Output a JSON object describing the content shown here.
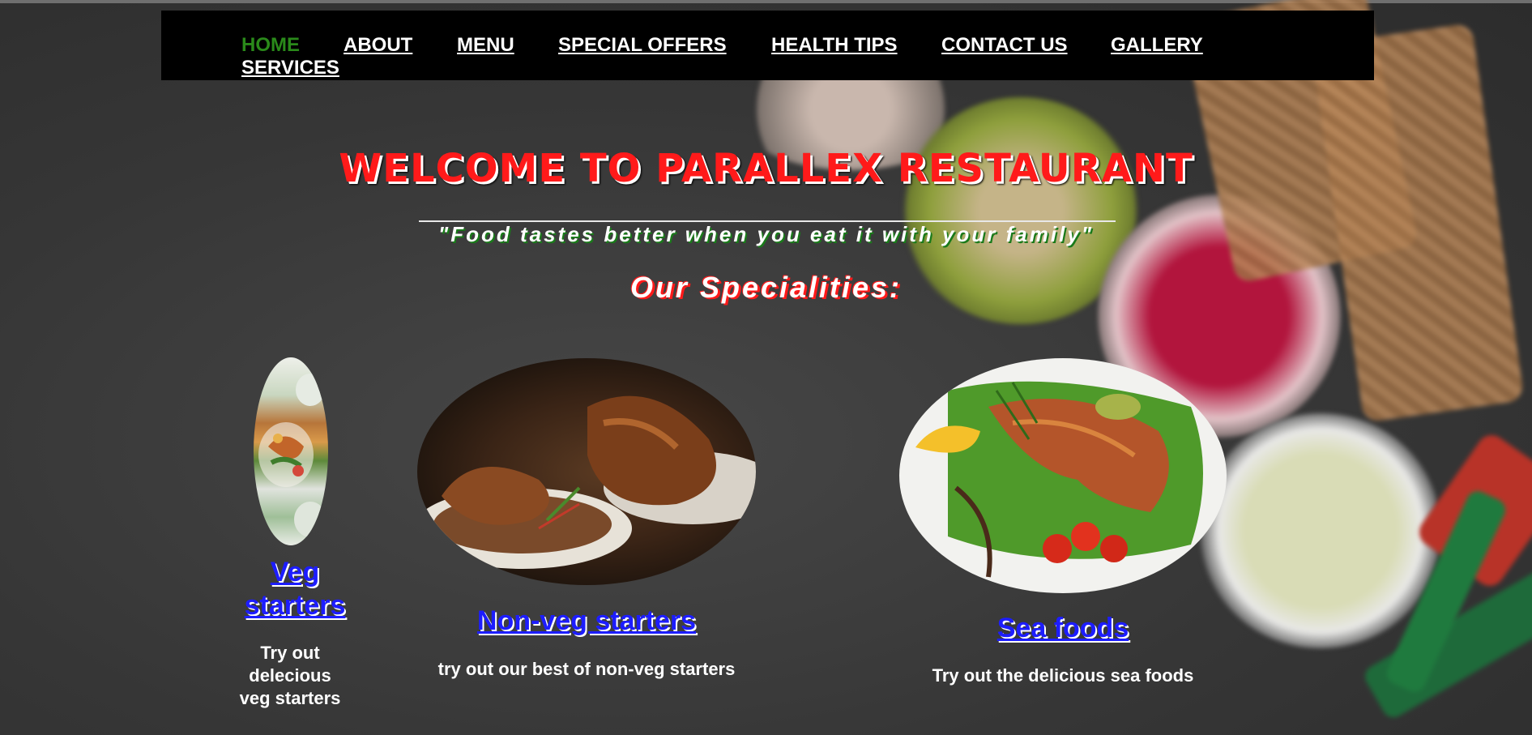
{
  "nav": {
    "items": [
      {
        "label": "HOME",
        "active": true
      },
      {
        "label": "ABOUT"
      },
      {
        "label": "MENU"
      },
      {
        "label": "SPECIAL OFFERS"
      },
      {
        "label": "HEALTH TIPS"
      },
      {
        "label": "CONTACT US"
      },
      {
        "label": "GALLERY"
      },
      {
        "label": "SERVICES"
      }
    ]
  },
  "hero": {
    "title": "WELCOME TO PARALLEX RESTAURANT",
    "quote": "\"Food tastes better when you eat it with your family\"",
    "subtitle": "Our Specialities:"
  },
  "specialities": [
    {
      "title": "Veg starters",
      "description": "Try out delecious veg starters",
      "image": "veg-salad-bowl"
    },
    {
      "title": "Non-veg starters",
      "description": "try out our best of non-veg starters",
      "image": "roast-chicken-plate"
    },
    {
      "title": "Sea foods",
      "description": "Try out the delicious sea foods",
      "image": "grilled-salmon-plate"
    }
  ],
  "colors": {
    "accent_red": "#ff1a1a",
    "active_green": "#2a8a1a",
    "link_blue": "#1d1dff",
    "nav_bg": "#000000"
  }
}
